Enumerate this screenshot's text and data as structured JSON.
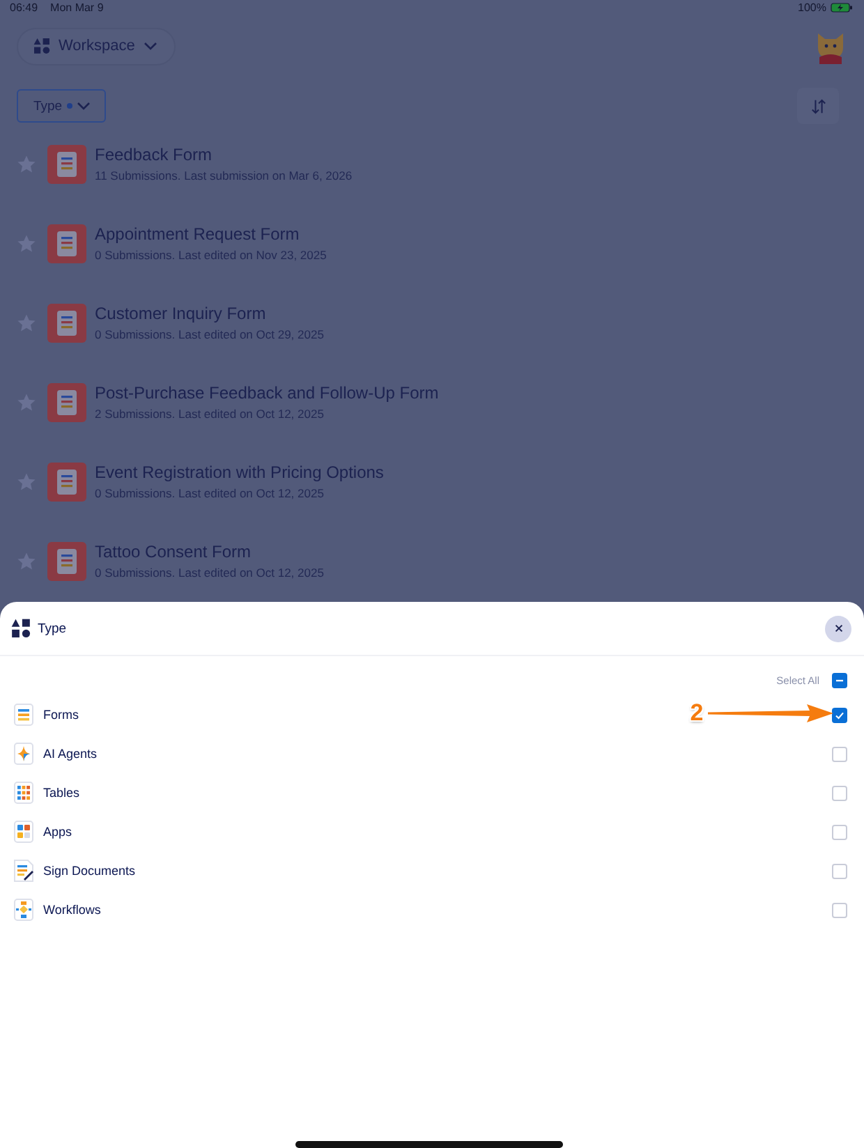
{
  "status_bar": {
    "time": "06:49",
    "date": "Mon Mar 9",
    "battery": "100%"
  },
  "header": {
    "workspace": "Workspace"
  },
  "toolbar": {
    "filter_label": "Type",
    "filter_active": true
  },
  "forms": [
    {
      "title": "Feedback Form",
      "subtitle": "11 Submissions. Last submission on Mar 6, 2026",
      "starred": false
    },
    {
      "title": "Appointment Request Form",
      "subtitle": "0 Submissions. Last edited on Nov 23, 2025",
      "starred": false
    },
    {
      "title": "Customer Inquiry Form",
      "subtitle": "0 Submissions. Last edited on Oct 29, 2025",
      "starred": false
    },
    {
      "title": "Post-Purchase Feedback and Follow-Up Form",
      "subtitle": "2 Submissions. Last edited on Oct 12, 2025",
      "starred": false
    },
    {
      "title": "Event Registration with Pricing Options",
      "subtitle": "0 Submissions. Last edited on Oct 12, 2025",
      "starred": false
    },
    {
      "title": "Tattoo Consent Form",
      "subtitle": "0 Submissions. Last edited on Oct 12, 2025",
      "starred": false
    }
  ],
  "sheet": {
    "title": "Type",
    "select_all": {
      "label": "Select All",
      "partial": true
    },
    "options": [
      {
        "kind": "forms",
        "label": "Forms",
        "checked": true
      },
      {
        "kind": "agents",
        "label": "AI Agents",
        "checked": false
      },
      {
        "kind": "tables",
        "label": "Tables",
        "checked": false
      },
      {
        "kind": "apps",
        "label": "Apps",
        "checked": false
      },
      {
        "kind": "sign",
        "label": "Sign Documents",
        "checked": false
      },
      {
        "kind": "workflows",
        "label": "Workflows",
        "checked": false
      }
    ],
    "annotation": {
      "label": "2"
    }
  }
}
